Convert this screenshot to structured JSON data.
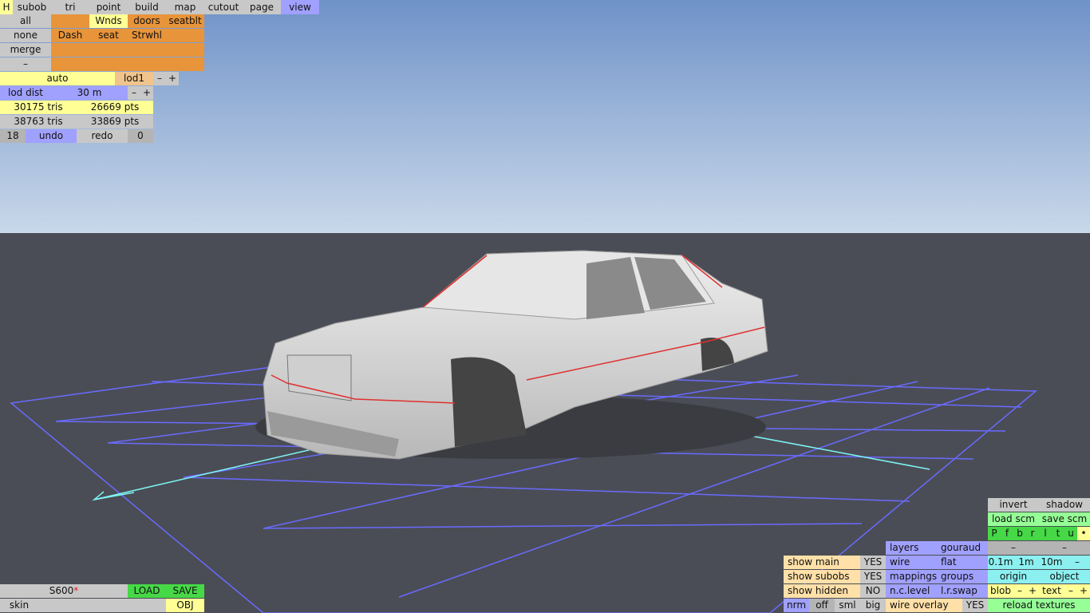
{
  "menu": [
    "H",
    "subob",
    "tri",
    "point",
    "build",
    "map",
    "cutout",
    "page",
    "view"
  ],
  "groups": {
    "col_labels": [
      "all",
      "none",
      "merge",
      "–"
    ],
    "row1": [
      "",
      "Wnds",
      "doors",
      "seatblt"
    ],
    "row2": [
      "Dash",
      "seat",
      "Strwhl",
      ""
    ],
    "row3": [
      "",
      "",
      "",
      ""
    ],
    "row4": [
      "",
      "",
      "",
      ""
    ]
  },
  "lod": {
    "auto": "auto",
    "lod1": "lod1",
    "minus": "–",
    "plus": "+",
    "dist_label": "lod dist",
    "dist_value": "30 m"
  },
  "stats": {
    "tris1": "30175 tris",
    "pts1": "26669 pts",
    "tris2": "38763 tris",
    "pts2": "33869 pts"
  },
  "history": {
    "count": "18",
    "undo": "undo",
    "redo": "redo",
    "redo_count": "0"
  },
  "file": {
    "name": "S600",
    "modified_mark": "*",
    "load": "LOAD",
    "save": "SAVE",
    "skin": "skin",
    "obj": "OBJ"
  },
  "view_panel": {
    "invert": "invert",
    "shadow": "shadow",
    "load_scm": "load scm",
    "save_scm": "save scm",
    "letters": [
      "P",
      "f",
      "b",
      "r",
      "l",
      "t",
      "u",
      "•"
    ],
    "dash1": "–",
    "dash2": "–",
    "layers": "layers",
    "gouraud": "gouraud",
    "wire": "wire",
    "flat": "flat",
    "mappings": "mappings",
    "groups": "groups",
    "nc_level": "n.c.level",
    "lr_swap": "l.r.swap",
    "wire_overlay": "wire overlay",
    "yes": "YES",
    "no": "NO",
    "show_main": "show main",
    "show_subobs": "show subobs",
    "show_hidden": "show hidden",
    "grid": [
      "0.1m",
      "1m",
      "10m",
      "–"
    ],
    "origin": "origin",
    "object": "object",
    "blob": "blob",
    "text": "text",
    "minus": "–",
    "plus": "+",
    "nrm": "nrm",
    "off": "off",
    "sml": "sml",
    "big": "big",
    "reload": "reload textures"
  },
  "colors": {
    "sky_top": "#6f92c8",
    "sky_bottom": "#c8d8ea",
    "ground": "#4a4d55",
    "grid": "#6a6aff",
    "axis": "#7ef5f5"
  }
}
